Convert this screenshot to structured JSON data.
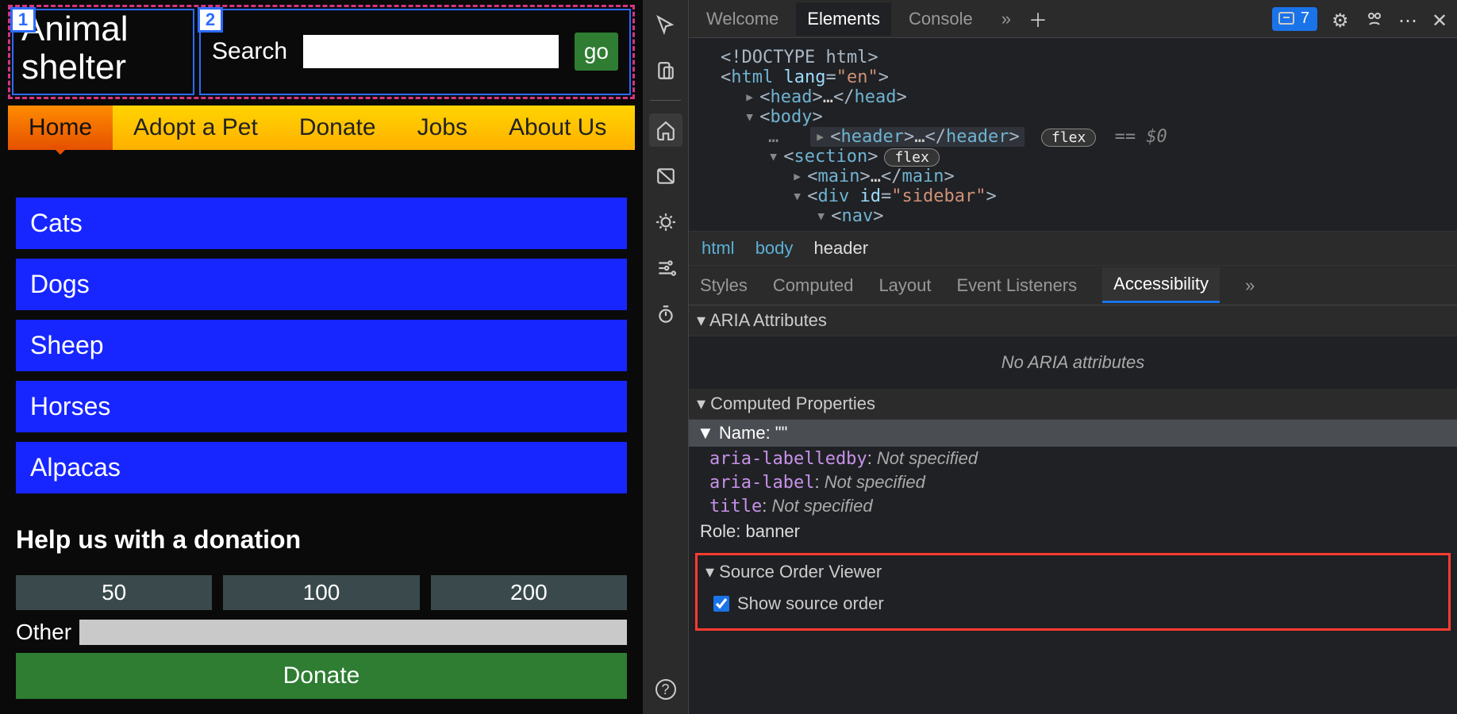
{
  "page": {
    "site_title": "Animal shelter",
    "order_badges": [
      "1",
      "2"
    ],
    "search": {
      "label": "Search",
      "go": "go"
    },
    "nav": [
      "Home",
      "Adopt a Pet",
      "Donate",
      "Jobs",
      "About Us"
    ],
    "animals": [
      "Cats",
      "Dogs",
      "Sheep",
      "Horses",
      "Alpacas"
    ],
    "donation": {
      "title": "Help us with a donation",
      "amounts": [
        "50",
        "100",
        "200"
      ],
      "other_label": "Other",
      "button": "Donate"
    }
  },
  "devtools": {
    "tabs": {
      "welcome": "Welcome",
      "elements": "Elements",
      "console": "Console"
    },
    "more_tabs_glyph": "»",
    "issues_count": "7",
    "dom": {
      "doctype": "<!DOCTYPE html>",
      "html_tag": "html",
      "html_lang": "lang=\"en\"",
      "head": "head",
      "body": "body",
      "header": "header",
      "section": "section",
      "main": "main",
      "div_id": "div",
      "div_id_attr": "id=\"sidebar\"",
      "nav": "nav",
      "flex_pill": "flex",
      "eq": "== $0",
      "ellipsis": "…"
    },
    "breadcrumbs": [
      "html",
      "body",
      "header"
    ],
    "subtabs": [
      "Styles",
      "Computed",
      "Layout",
      "Event Listeners",
      "Accessibility"
    ],
    "a11y": {
      "aria_attributes_title": "ARIA Attributes",
      "no_aria": "No ARIA attributes",
      "computed_props_title": "Computed Properties",
      "name_label": "Name: \"\"",
      "aria_labelledby": "aria-labelledby",
      "aria_label": "aria-label",
      "title_prop": "title",
      "not_specified": "Not specified",
      "role_label": "Role:",
      "role_value": "banner",
      "sov_title": "Source Order Viewer",
      "sov_checkbox": "Show source order"
    }
  }
}
